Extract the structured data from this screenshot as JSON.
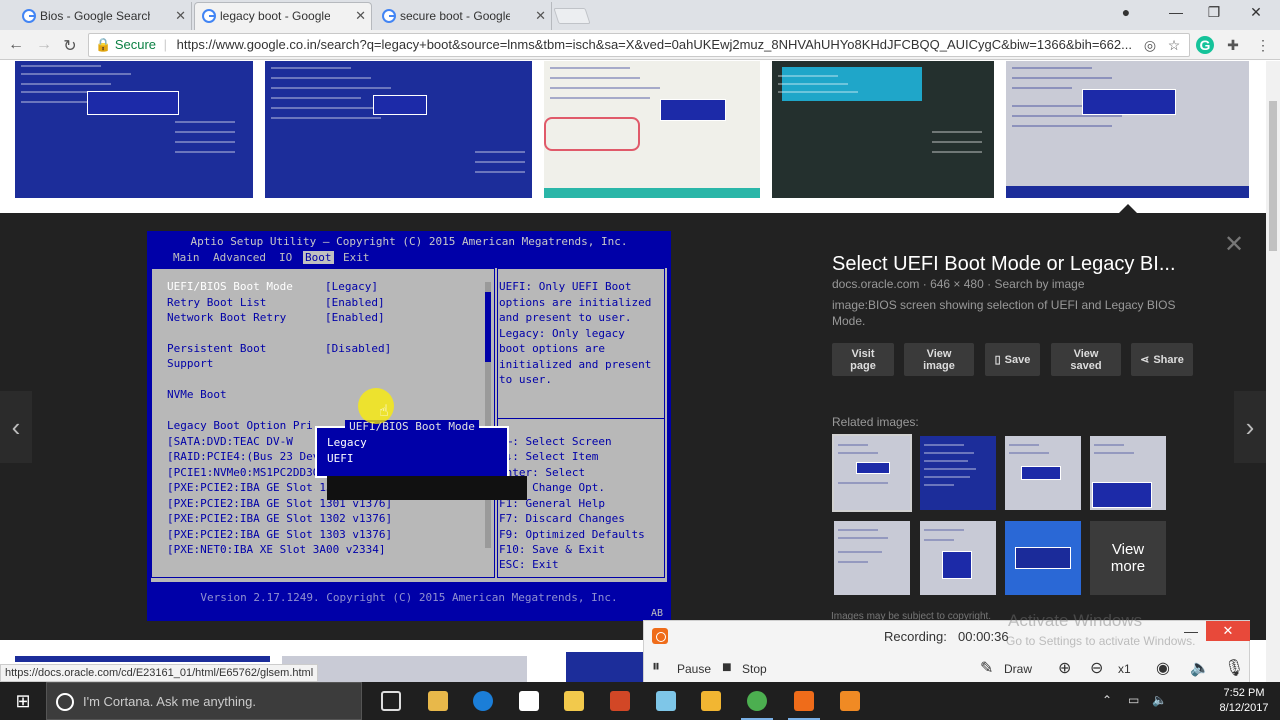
{
  "browser": {
    "tabs": [
      {
        "title": "Bios - Google Search",
        "close": "✕"
      },
      {
        "title": "legacy boot - Google Se",
        "close": "✕"
      },
      {
        "title": "secure boot - Google Se",
        "close": "✕"
      }
    ],
    "window_controls": {
      "minimize": "—",
      "restore": "❐",
      "close": "✕",
      "profile": "●"
    },
    "nav": {
      "back": "←",
      "forward": "→",
      "reload": "↻"
    },
    "address": {
      "lock": "🔒",
      "secure_label": "Secure",
      "url": "https://www.google.co.in/search?q=legacy+boot&source=lnms&tbm=isch&sa=X&ved=0ahUKEwj2muz_8NHVAhUHYo8KHdJFCBQQ_AUICygC&biw=1366&bih=662..."
    },
    "extensions": {
      "target": "◎",
      "star": "☆",
      "grammarly": "G",
      "puzzle": "✚",
      "menu": "⋮"
    }
  },
  "viewer": {
    "close": "✕",
    "prev": "‹",
    "next": "›",
    "bios": {
      "header": "Aptio Setup Utility – Copyright (C) 2015 American Megatrends, Inc.",
      "menus": [
        "Main",
        "Advanced",
        "IO",
        "Boot",
        "Exit"
      ],
      "selected_menu": "Boot",
      "settings": [
        {
          "label": "UEFI/BIOS Boot Mode",
          "value": "[Legacy]"
        },
        {
          "label": "Retry Boot List",
          "value": "[Enabled]"
        },
        {
          "label": "Network Boot Retry",
          "value": "[Enabled]"
        },
        {
          "label": "Persistent Boot",
          "value": "[Disabled]"
        },
        {
          "label": "Support",
          "value": ""
        },
        {
          "label": "NVMe Boot",
          "value": ""
        },
        {
          "label": "Legacy Boot Option Pri",
          "value": ""
        }
      ],
      "boot_options": [
        "[SATA:DVD:TEAC      DV-W",
        "[RAID:PCIE4:(Bus 23 Dev",
        "[PCIE1:NVMe0:MS1PC2DD3ORA3.2T ]",
        "[PXE:PCIE2:IBA GE Slot 1300 v1376]",
        "[PXE:PCIE2:IBA GE Slot 1301 v1376]",
        "[PXE:PCIE2:IBA GE Slot 1302 v1376]",
        "[PXE:PCIE2:IBA GE Slot 1303 v1376]",
        "[PXE:NET0:IBA XE Slot 3A00 v2334]"
      ],
      "help_text": [
        "UEFI: Only UEFI Boot",
        "options are initialized",
        "and present to user.",
        "Legacy: Only legacy",
        "boot options are",
        "initialized and present",
        "to user."
      ],
      "keys": [
        "→←: Select Screen",
        "↑↓: Select Item",
        "Enter: Select",
        "+/-: Change Opt.",
        "F1: General Help",
        "F7: Discard Changes",
        "F9: Optimized Defaults",
        "F10: Save & Exit",
        "ESC: Exit"
      ],
      "popup": {
        "title": "UEFI/BIOS Boot Mode",
        "options": [
          "Legacy",
          "UEFI"
        ]
      },
      "footer": "Version 2.17.1249. Copyright (C) 2015 American Megatrends, Inc.",
      "corner": "AB"
    },
    "info": {
      "title": "Select UEFI Boot Mode or Legacy BI...",
      "source": "docs.oracle.com",
      "size": "646 × 480",
      "search_by_image": "Search by image",
      "description": "image:BIOS screen showing selection of UEFI and Legacy BIOS Mode."
    },
    "actions": [
      {
        "label": "Visit page",
        "icon": ""
      },
      {
        "label": "View image",
        "icon": ""
      },
      {
        "label": "Save",
        "icon": "▯"
      },
      {
        "label": "View saved",
        "icon": ""
      },
      {
        "label": "Share",
        "icon": "⋖"
      }
    ],
    "related_label": "Related images:",
    "view_more": "View more",
    "copyright_note": "Images may be subject to copyright."
  },
  "status_url": "https://docs.oracle.com/cd/E23161_01/html/E65762/glsem.html",
  "recorder": {
    "label": "Recording:",
    "time": "00:00:36",
    "pause": "Pause",
    "stop": "Stop",
    "draw": "Draw",
    "zoom_level": "x1",
    "minimize": "—",
    "close": "✕",
    "watermark_title": "Activate Windows",
    "watermark_sub": "Go to Settings to activate Windows."
  },
  "taskbar": {
    "start": "⊞",
    "cortana_placeholder": "I'm Cortana. Ask me anything.",
    "clock_time": "7:52 PM",
    "clock_date": "8/12/2017",
    "tray": {
      "chevron": "⌃",
      "network": "▭",
      "volume": "🔈"
    }
  },
  "colors": {
    "bios_blue": "#0000a8",
    "bios_grey": "#b8b8b8",
    "viewer_bg": "#222222",
    "recorder_accent": "#ef6c1a"
  }
}
